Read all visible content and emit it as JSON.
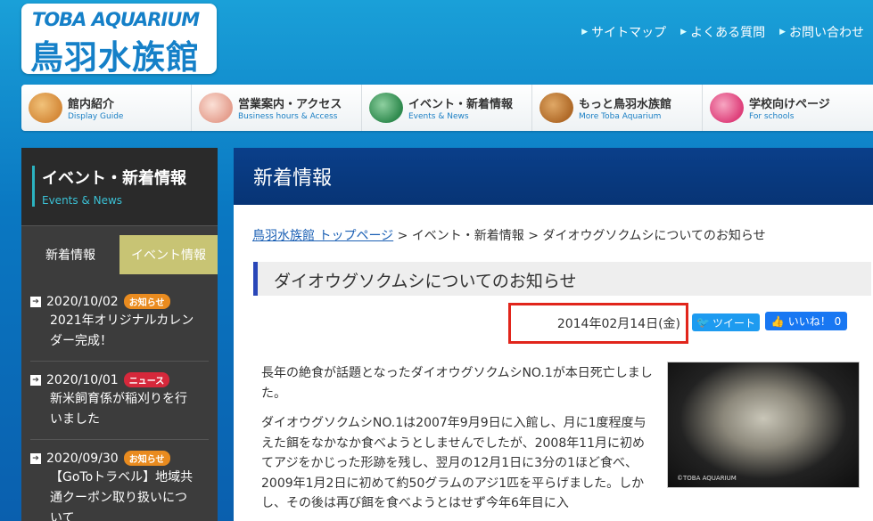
{
  "header": {
    "logo_en": "TOBA AQUARIUM",
    "logo_jp": "鳥羽水族館",
    "links": [
      {
        "label": "サイトマップ"
      },
      {
        "label": "よくある質問"
      },
      {
        "label": "お問い合わせ"
      }
    ]
  },
  "gnav": [
    {
      "jp": "館内紹介",
      "en": "Display Guide",
      "icon": "walrus-icon",
      "color": "#e6a04a"
    },
    {
      "jp": "営業案内・アクセス",
      "en": "Business hours & Access",
      "icon": "pelican-icon",
      "color": "#e8a89a"
    },
    {
      "jp": "イベント・新着情報",
      "en": "Events & News",
      "icon": "turtle-icon",
      "color": "#3a9a5a"
    },
    {
      "jp": "もっと鳥羽水族館",
      "en": "More Toba  Aquarium",
      "icon": "capybara-icon",
      "color": "#c07a34"
    },
    {
      "jp": "学校向けページ",
      "en": "For schools",
      "icon": "seaslug-icon",
      "color": "#e35a8c"
    }
  ],
  "sidebar": {
    "title": "イベント・新着情報",
    "subtitle": "Events & News",
    "tabs": [
      "新着情報",
      "イベント情報"
    ],
    "entries": [
      {
        "date": "2020/10/02",
        "badge": "お知らせ",
        "badge_type": "info",
        "text": [
          "2021年オリジナルカレン",
          "ダー完成！"
        ]
      },
      {
        "date": "2020/10/01",
        "badge": "ニュース",
        "badge_type": "news",
        "text": [
          "新米飼育係が稲刈りを行",
          "いました"
        ]
      },
      {
        "date": "2020/09/30",
        "badge": "お知らせ",
        "badge_type": "info",
        "text": [
          "【GoToトラベル】地域共",
          "通クーポン取り扱いにつ",
          "いて"
        ]
      }
    ]
  },
  "main": {
    "heading": "新着情報",
    "breadcrumb": {
      "home": "鳥羽水族館 トップページ",
      "sep1": " > ",
      "section": "イベント・新着情報",
      "sep2": " > ",
      "current": "ダイオウグソクムシについてのお知らせ"
    },
    "article_title": "ダイオウグソクムシについてのお知らせ",
    "date": "2014年02月14日(金)",
    "tweet_label": "ツイート",
    "like_label": "いいね！ 0",
    "paragraphs": [
      "長年の絶食が話題となったダイオウグソクムシNO.1が本日死亡しました。",
      "ダイオウグソクムシNO.1は2007年9月9日に入館し、月に1度程度与えた餌をなかなか食べようとしませんでしたが、2008年11月に初めてアジをかじった形跡を残し、翌月の12月1日に3分の1ほど食べ、2009年1月2日に初めて約50グラムのアジ1匹を平らげました。しかし、その後は再び餌を食べようとはせず今年6年目に入"
    ],
    "photo_credit": "©TOBA AQUARIUM"
  },
  "colors": {
    "accent_blue": "#0a3f8a",
    "highlight_red": "#e1251b",
    "tab_inactive": "#c8c474"
  }
}
